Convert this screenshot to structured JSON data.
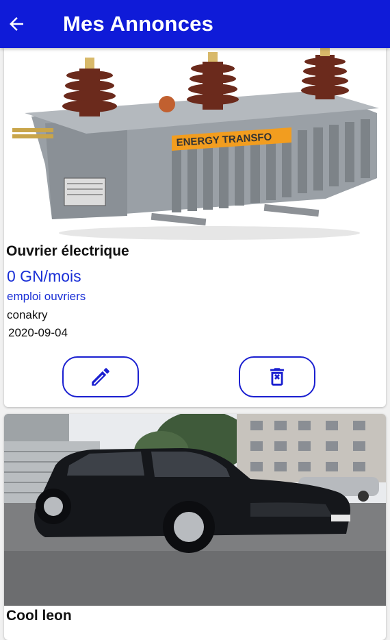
{
  "appbar": {
    "title": "Mes Annonces",
    "back_icon": "arrow-back-icon"
  },
  "colors": {
    "primary": "#0f1bd8",
    "link_blue": "#1a2fd6",
    "orange_label": "#f29d1f"
  },
  "listings": [
    {
      "image_label": "ENERGY TRANSFO",
      "title": "Ouvrier électrique",
      "price": "0 GN/mois",
      "category": "emploi ouvriers",
      "location": "conakry",
      "date": "2020-09-04",
      "edit_icon": "pencil-icon",
      "delete_icon": "trash-icon"
    },
    {
      "title": "Cool leon"
    }
  ]
}
